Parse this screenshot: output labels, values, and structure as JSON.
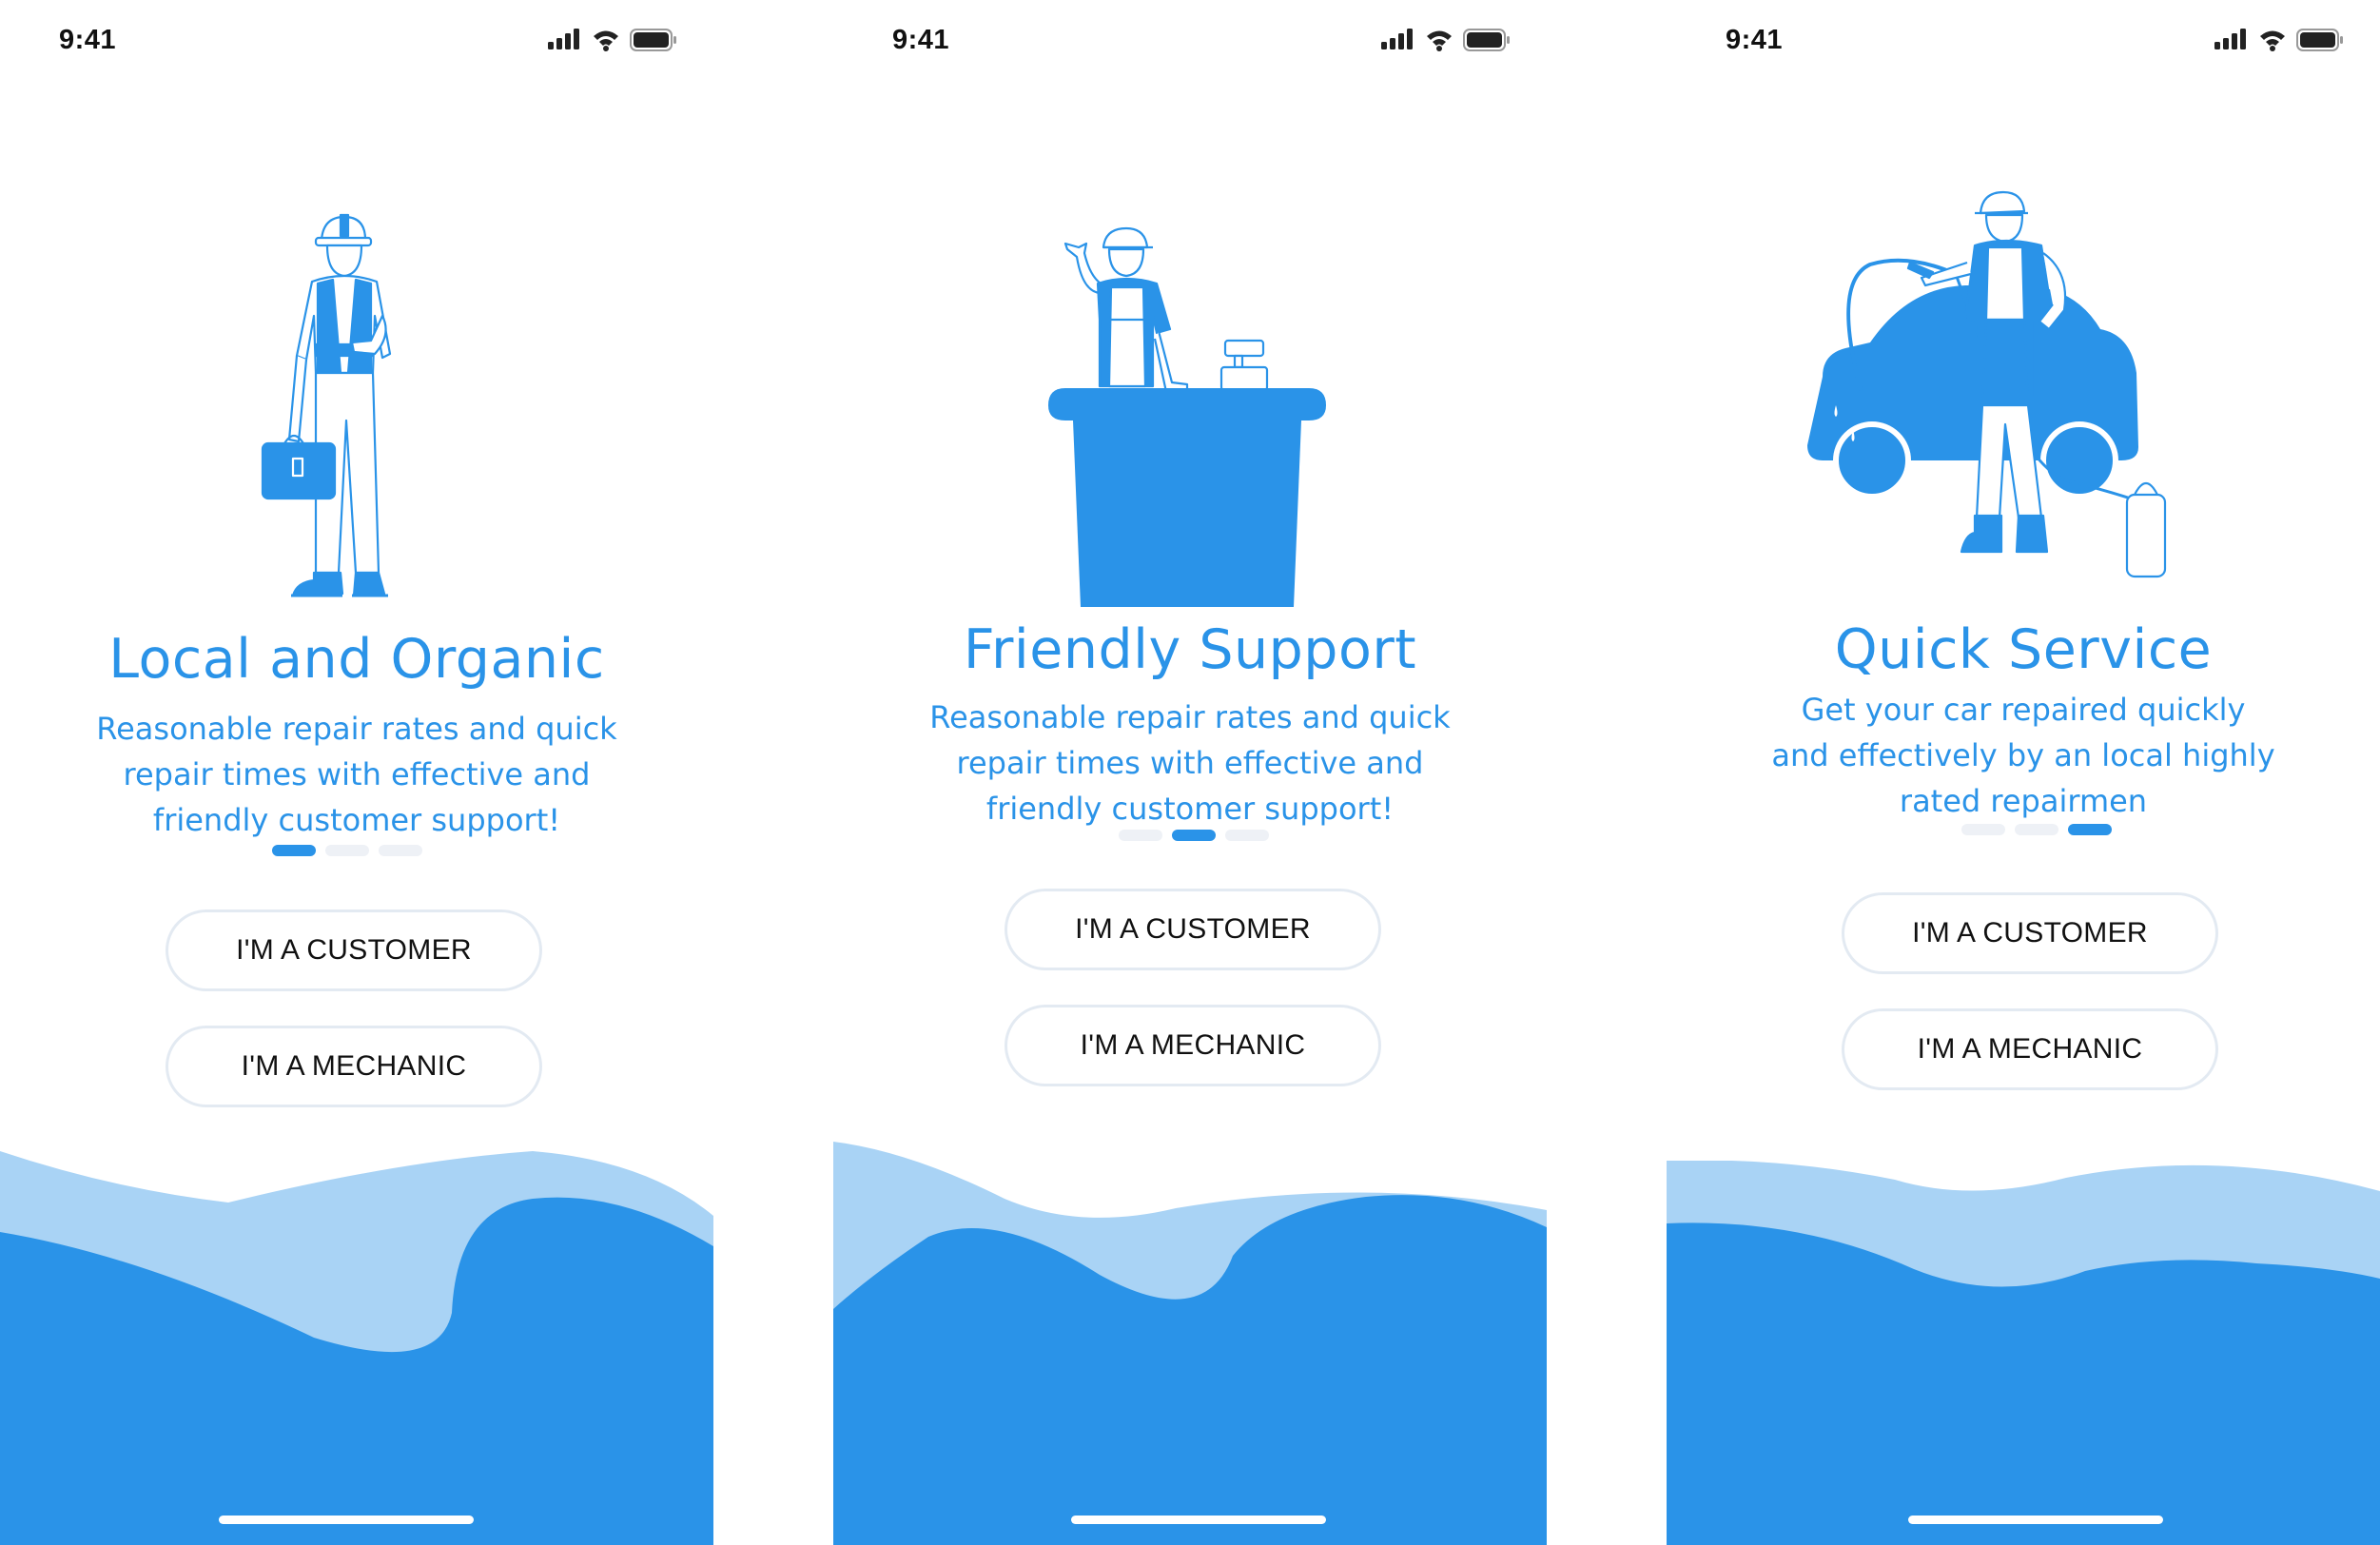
{
  "colors": {
    "accent": "#2a93e8",
    "accent_light": "#a9d3f5",
    "dot_inactive": "#eef1f6",
    "button_border": "#e3eaf2"
  },
  "screens": [
    {
      "status_time": "9:41",
      "illustration": "mechanic-with-toolbag-illustration",
      "title": "Local and Organic",
      "description_lines": [
        "Reasonable repair rates and quick",
        "repair times with effective and",
        "friendly customer support!"
      ],
      "page_indicator": {
        "total": 3,
        "active": 1
      },
      "customer_button": "I'M A CUSTOMER",
      "mechanic_button": "I'M A MECHANIC"
    },
    {
      "status_time": "9:41",
      "illustration": "support-desk-clerk-illustration",
      "title": "Friendly Support",
      "description_lines": [
        "Reasonable repair rates and quick",
        "repair times with effective and",
        "friendly customer support!"
      ],
      "page_indicator": {
        "total": 3,
        "active": 2
      },
      "customer_button": "I'M A CUSTOMER",
      "mechanic_button": "I'M A MECHANIC"
    },
    {
      "status_time": "9:41",
      "illustration": "car-wash-worker-illustration",
      "title": "Quick Service",
      "description_lines": [
        "Get your car repaired quickly",
        "and effectively  by an local highly",
        "rated repairmen"
      ],
      "page_indicator": {
        "total": 3,
        "active": 3
      },
      "customer_button": "I'M A CUSTOMER",
      "mechanic_button": "I'M A MECHANIC"
    }
  ]
}
